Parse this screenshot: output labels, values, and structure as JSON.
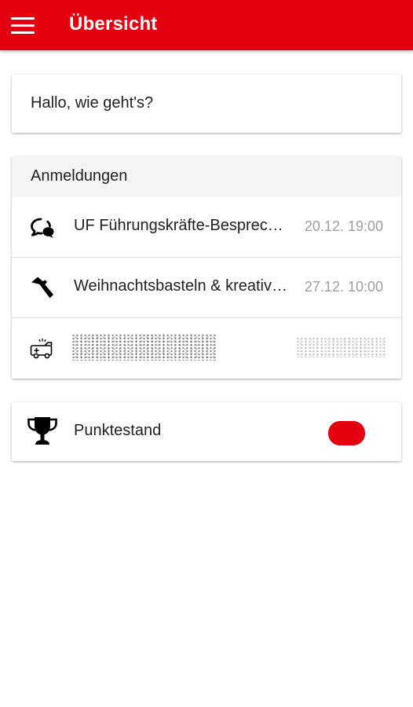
{
  "appbar": {
    "title": "Übersicht",
    "background_color": "#e3000f",
    "menu_icon": "hamburger-menu-icon"
  },
  "greeting": {
    "text": "Hallo, wie geht's?"
  },
  "registrations": {
    "header": "Anmeldungen",
    "items": [
      {
        "icon": "chat-bubbles-icon",
        "title": "UF Führungskräfte-Besprechung",
        "date": "20.12. 19:00"
      },
      {
        "icon": "hammer-icon",
        "title": "Weihnachtsbasteln & kreatives",
        "date": "27.12. 10:00"
      },
      {
        "icon": "ambulance-icon",
        "title": "",
        "date": "",
        "redacted": true
      }
    ]
  },
  "score": {
    "icon": "trophy-icon",
    "label": "Punktestand",
    "value": "",
    "badge_color": "#e3000f"
  }
}
